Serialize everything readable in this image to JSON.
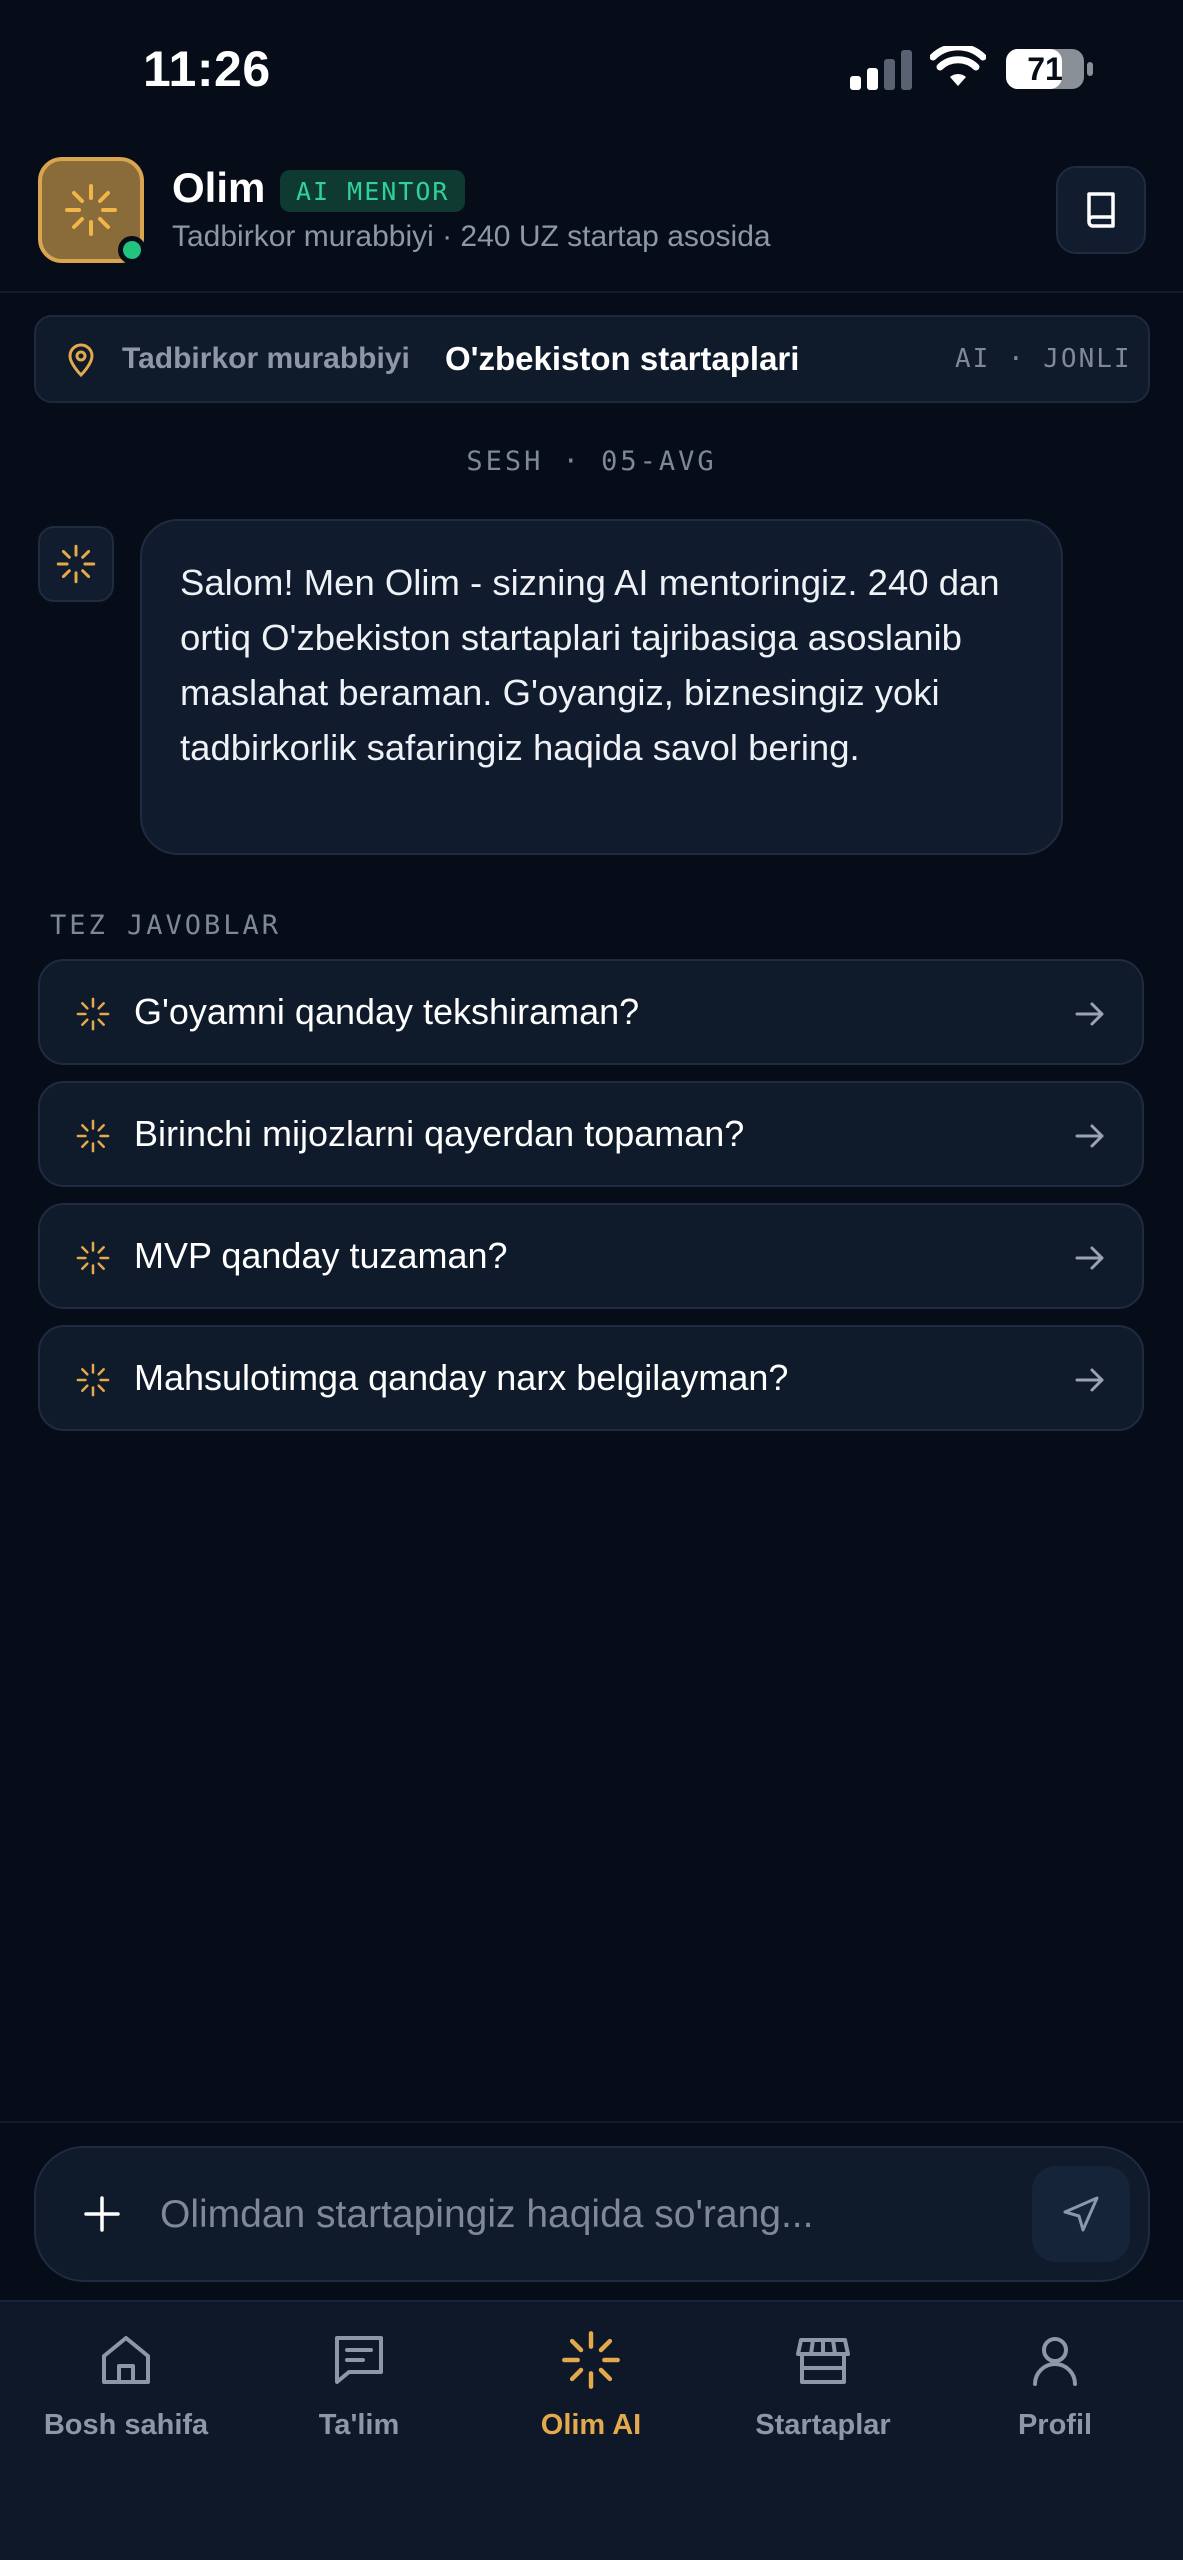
{
  "status_bar": {
    "time": "11:26",
    "battery": "71"
  },
  "header": {
    "name": "Olim",
    "badge": "AI MENTOR",
    "subtitle": "Tadbirkor murabbiyi · 240 UZ startap asosida"
  },
  "context": {
    "label": "Tadbirkor murabbiyi",
    "value": "O'zbekiston startaplari",
    "status": "AI · JONLI"
  },
  "session": {
    "label": "SESH · 05-AVG"
  },
  "chat": {
    "messages": [
      {
        "role": "bot",
        "text": "Salom! Men Olim - sizning AI mentoringiz. 240 dan ortiq O'zbekiston startaplari tajribasiga asoslanib maslahat beraman. G'oyangiz, biznesingiz yoki tadbirkorlik safaringiz haqida savol bering."
      }
    ]
  },
  "quick_replies": {
    "title": "TEZ JAVOBLAR",
    "items": [
      {
        "label": "G'oyamni qanday tekshiraman?"
      },
      {
        "label": "Birinchi mijozlarni qayerdan topaman?"
      },
      {
        "label": "MVP qanday tuzaman?"
      },
      {
        "label": "Mahsulotimga qanday narx belgilayman?"
      }
    ]
  },
  "input": {
    "placeholder": "Olimdan startapingiz haqida so'rang..."
  },
  "nav": {
    "items": [
      {
        "label": "Bosh sahifa",
        "icon": "home-icon"
      },
      {
        "label": "Ta'lim",
        "icon": "message-square-icon"
      },
      {
        "label": "Olim AI",
        "icon": "sparkle-icon",
        "active": true
      },
      {
        "label": "Startaplar",
        "icon": "store-icon"
      },
      {
        "label": "Profil",
        "icon": "user-icon"
      }
    ]
  },
  "colors": {
    "background": "#070d18",
    "accent": "#e2a94d",
    "badge_green": "#2fd39a",
    "online": "#22c37e"
  }
}
